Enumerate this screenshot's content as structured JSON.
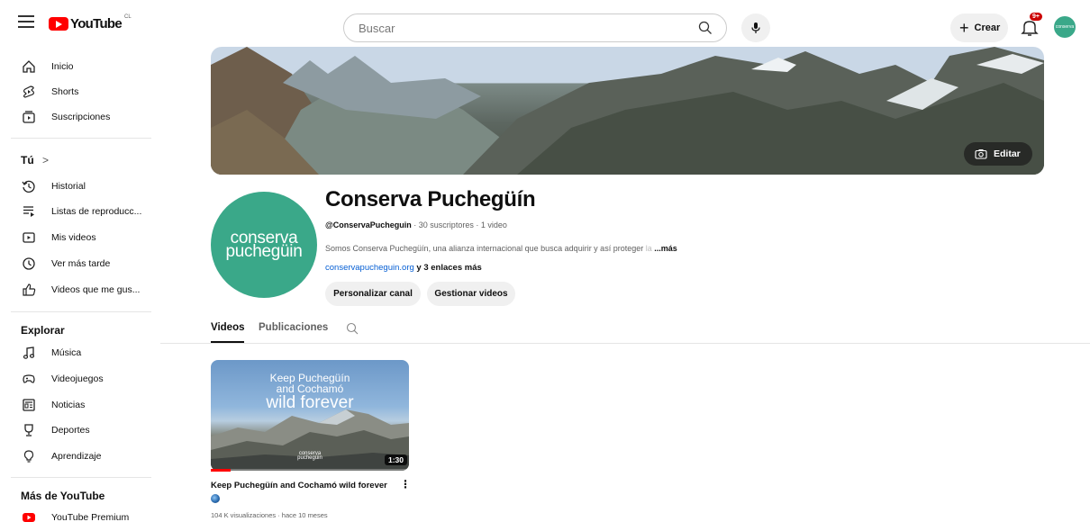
{
  "topbar": {
    "logo_text": "YouTube",
    "region": "CL",
    "search_placeholder": "Buscar",
    "create_label": "Crear",
    "create_plus": "+",
    "notification_count": "9+",
    "avatar_text": "conserva"
  },
  "sidebar": {
    "main": [
      {
        "label": "Inicio",
        "icon": "home-icon"
      },
      {
        "label": "Shorts",
        "icon": "shorts-icon"
      },
      {
        "label": "Suscripciones",
        "icon": "subscriptions-icon"
      }
    ],
    "you_header": "Tú",
    "you_chevron": ">",
    "you": [
      {
        "label": "Historial",
        "icon": "history-icon"
      },
      {
        "label": "Listas de reproducc...",
        "icon": "playlists-icon"
      },
      {
        "label": "Mis videos",
        "icon": "my-videos-icon"
      },
      {
        "label": "Ver más tarde",
        "icon": "watch-later-icon"
      },
      {
        "label": "Videos que me gus...",
        "icon": "liked-videos-icon"
      }
    ],
    "explore_header": "Explorar",
    "explore": [
      {
        "label": "Música",
        "icon": "music-icon"
      },
      {
        "label": "Videojuegos",
        "icon": "gaming-icon"
      },
      {
        "label": "Noticias",
        "icon": "news-icon"
      },
      {
        "label": "Deportes",
        "icon": "sports-icon"
      },
      {
        "label": "Aprendizaje",
        "icon": "learning-icon"
      }
    ],
    "more_header": "Más de YouTube",
    "more": [
      {
        "label": "YouTube Premium",
        "icon": "youtube-premium-icon"
      }
    ]
  },
  "banner": {
    "edit_label": "Editar"
  },
  "channel": {
    "avatar_line1": "conserva",
    "avatar_line2": "puchegüin",
    "name": "Conserva Puchegüín",
    "handle": "@ConservaPucheguin",
    "meta_rest": " · 30 suscriptores · 1 video",
    "description": "Somos Conserva Puchegüín, una alianza internacional que busca adquirir y así proteger ",
    "description_fade": "la",
    "description_more": " ...más",
    "link": "conservapucheguin.org",
    "more_links": " y 3 enlaces más",
    "customize_label": "Personalizar canal",
    "manage_label": "Gestionar videos"
  },
  "tabs": [
    {
      "label": "Videos",
      "active": true
    },
    {
      "label": "Publicaciones",
      "active": false
    }
  ],
  "video": {
    "thumb_line1": "Keep Puchegüín",
    "thumb_line2": "and Cochamó",
    "thumb_line3": "wild forever",
    "thumb_logo1": "conserva",
    "thumb_logo2": "puchegüin",
    "duration": "1:30",
    "progress": 0.1,
    "title": "Keep Puchegüín and Cochamó wild forever",
    "kebab": "⋮",
    "stats": "104 K visualizaciones · hace 10 meses"
  }
}
